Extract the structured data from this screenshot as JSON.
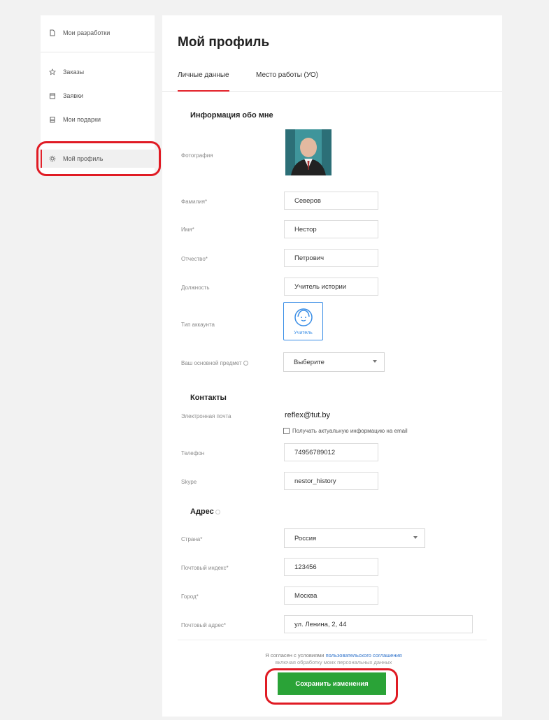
{
  "sidebar": {
    "items": [
      {
        "label": "Мои разработки",
        "icon": "document-icon"
      },
      {
        "label": "Заказы",
        "icon": "star-icon"
      },
      {
        "label": "Заявки",
        "icon": "calendar-icon"
      },
      {
        "label": "Мои подарки",
        "icon": "gift-icon"
      },
      {
        "label": "Мой профиль",
        "icon": "gear-icon",
        "active": true
      }
    ]
  },
  "main": {
    "title": "Мой профиль",
    "tabs": [
      {
        "label": "Личные данные",
        "active": true
      },
      {
        "label": "Место работы (УО)",
        "active": false
      }
    ]
  },
  "about": {
    "title": "Информация обо мне",
    "photo_label": "Фотография",
    "surname_label": "Фамилия*",
    "surname_value": "Северов",
    "name_label": "Имя*",
    "name_value": "Нестор",
    "patronymic_label": "Отчество*",
    "patronymic_value": "Петрович",
    "position_label": "Должность",
    "position_value": "Учитель истории",
    "account_type_label": "Тип аккаунта",
    "account_type_value": "Учитель",
    "subject_label": "Ваш основной предмет",
    "subject_value": "Выберите"
  },
  "contacts": {
    "title": "Контакты",
    "email_label": "Электронная почта",
    "email_value": "reflex@tut.by",
    "subscribe_label": "Получать актуальную информацию на email",
    "phone_label": "Телефон",
    "phone_value": "74956789012",
    "skype_label": "Skype",
    "skype_value": "nestor_history"
  },
  "address": {
    "title": "Адрес",
    "country_label": "Страна*",
    "country_value": "Россия",
    "zip_label": "Почтовый индекс*",
    "zip_value": "123456",
    "city_label": "Город*",
    "city_value": "Москва",
    "street_label": "Почтовый адрес*",
    "street_value": "ул. Ленина, 2, 44"
  },
  "footer": {
    "agree_prefix": "Я согласен с условиями",
    "agree_link": "пользовательского соглашения",
    "agree_suffix": "включая обработку моих персональных данных",
    "save_label": "Сохранить изменения"
  },
  "colors": {
    "accent": "#e3222b",
    "save": "#2aa337",
    "link": "#2a6fc9",
    "highlight": "#e01b24"
  }
}
